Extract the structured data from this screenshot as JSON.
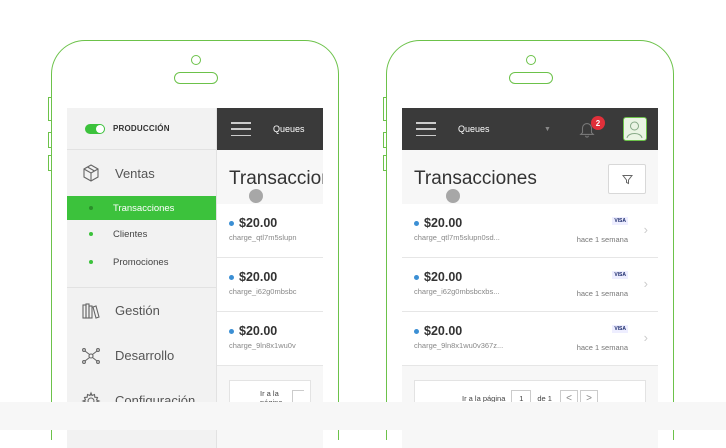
{
  "left": {
    "env_label": "PRODUCCIÓN",
    "menu": {
      "ventas": "Ventas",
      "sub": [
        "Transacciones",
        "Clientes",
        "Promociones"
      ],
      "gestion": "Gestión",
      "desarrollo": "Desarrollo",
      "configuracion": "Configuración"
    },
    "topbar": {
      "queues": "Queues"
    },
    "title": "Transaccion",
    "transactions": [
      {
        "amount": "$20.00",
        "id": "charge_qtl7m5slupn"
      },
      {
        "amount": "$20.00",
        "id": "charge_i62g0mbsbc"
      },
      {
        "amount": "$20.00",
        "id": "charge_9ln8x1wu0v"
      }
    ],
    "pager": {
      "label": "Ir a la página"
    }
  },
  "right": {
    "topbar": {
      "queues": "Queues",
      "notifications": "2"
    },
    "title": "Transacciones",
    "transactions": [
      {
        "amount": "$20.00",
        "id": "charge_qtl7m5slupn0sd...",
        "time": "hace 1 semana",
        "card": "VISA"
      },
      {
        "amount": "$20.00",
        "id": "charge_i62g0mbsbcxbs...",
        "time": "hace 1 semana",
        "card": "VISA"
      },
      {
        "amount": "$20.00",
        "id": "charge_9ln8x1wu0v367z...",
        "time": "hace 1 semana",
        "card": "VISA"
      }
    ],
    "pager": {
      "label": "Ir a la página",
      "page": "1",
      "of": "de 1",
      "prev": "<",
      "next": ">"
    }
  },
  "icons": {
    "toggle": "toggle-switch-icon",
    "ventas": "box-icon",
    "gestion": "books-icon",
    "desarrollo": "network-icon",
    "configuracion": "gear-icon",
    "menu": "hamburger-icon",
    "bell": "bell-icon",
    "filter": "filter-icon",
    "chevron": "chevron-right-icon"
  },
  "colors": {
    "accent": "#3cc23c",
    "topbar": "#3a3a3a",
    "badge": "#e0303a",
    "phone_outline": "#6cc24a"
  }
}
